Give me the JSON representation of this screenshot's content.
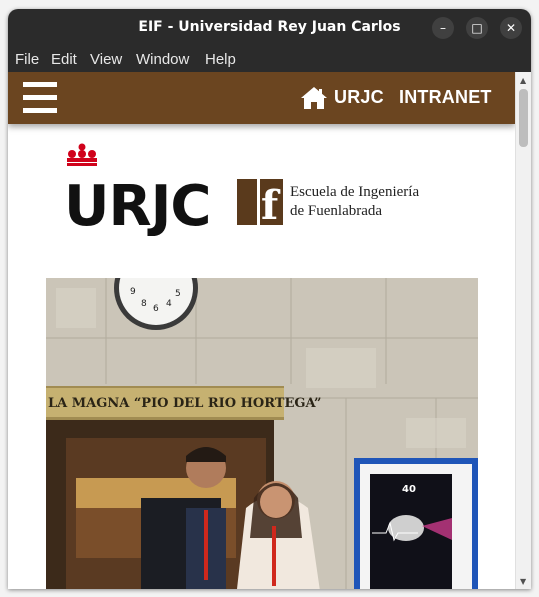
{
  "window": {
    "title": "EIF - Universidad Rey Juan Carlos",
    "controls": {
      "minimize": "–",
      "maximize": "□",
      "close": "✕"
    }
  },
  "menu": [
    "File",
    "Edit",
    "View",
    "Window",
    "Help"
  ],
  "navbar": {
    "bg_color": "#6b4520",
    "links": {
      "urjc": "URJC",
      "intranet": "INTRANET"
    }
  },
  "header": {
    "logo_text": "URJC",
    "logo_accent_color": "#d0021b",
    "eif_logo_letter": "f",
    "school_line1": "Escuela de Ingeniería",
    "school_line2": "de Fuenlabrada"
  },
  "photo": {
    "sign_text": "LA MAGNA “PIO DEL RIO HORTEGA”",
    "poster_number": "40"
  }
}
